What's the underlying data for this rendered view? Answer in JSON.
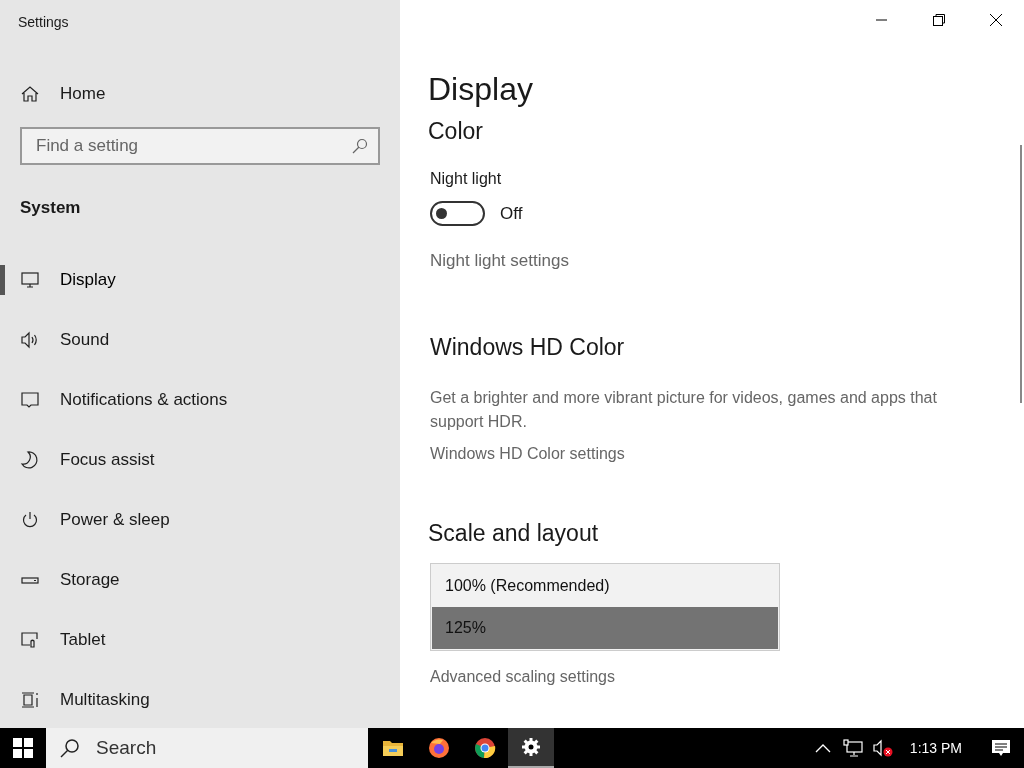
{
  "window": {
    "title": "Settings"
  },
  "sidebar": {
    "home": "Home",
    "search": {
      "placeholder": "Find a setting"
    },
    "section": "System",
    "items": [
      {
        "label": "Display",
        "selected": true
      },
      {
        "label": "Sound",
        "selected": false
      },
      {
        "label": "Notifications & actions",
        "selected": false
      },
      {
        "label": "Focus assist",
        "selected": false
      },
      {
        "label": "Power & sleep",
        "selected": false
      },
      {
        "label": "Storage",
        "selected": false
      },
      {
        "label": "Tablet",
        "selected": false
      },
      {
        "label": "Multitasking",
        "selected": false
      }
    ]
  },
  "main": {
    "title": "Display",
    "color_heading": "Color",
    "night_light": {
      "label": "Night light",
      "on": false,
      "state_text": "Off"
    },
    "night_light_link": "Night light settings",
    "hd_heading": "Windows HD Color",
    "hd_description": "Get a brighter and more vibrant picture for videos, games and apps that support HDR.",
    "hd_link": "Windows HD Color settings",
    "scale_heading": "Scale and layout",
    "scale_options": [
      {
        "label": "100% (Recommended)",
        "selected": false
      },
      {
        "label": "125%",
        "selected": true
      }
    ],
    "advanced_link": "Advanced scaling settings"
  },
  "taskbar": {
    "search": "Search",
    "apps": [
      {
        "selected": false
      },
      {
        "selected": false
      },
      {
        "selected": false
      },
      {
        "selected": true
      }
    ],
    "time": "1:13 PM"
  }
}
